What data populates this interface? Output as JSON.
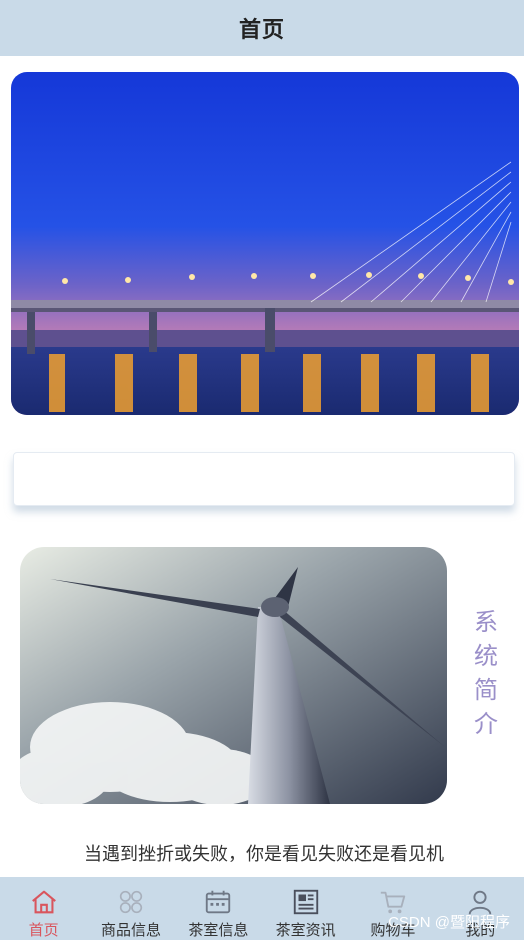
{
  "header": {
    "title": "首页"
  },
  "intro": {
    "title_chars": [
      "系",
      "统",
      "简",
      "介"
    ],
    "text": "当遇到挫折或失败，你是看见失败还是看见机"
  },
  "tabbar": {
    "items": [
      {
        "label": "首页",
        "icon": "home-icon",
        "active": true
      },
      {
        "label": "商品信息",
        "icon": "grid-icon",
        "active": false
      },
      {
        "label": "茶室信息",
        "icon": "calendar-icon",
        "active": false
      },
      {
        "label": "茶室资讯",
        "icon": "news-icon",
        "active": false
      },
      {
        "label": "购物车",
        "icon": "cart-icon",
        "active": false
      },
      {
        "label": "我的",
        "icon": "user-icon",
        "active": false
      }
    ]
  },
  "watermark": "CSDN @暨阳程序",
  "colors": {
    "bar": "#c9dae8",
    "active": "#d9555d",
    "intro_title": "#9a8fc9"
  }
}
